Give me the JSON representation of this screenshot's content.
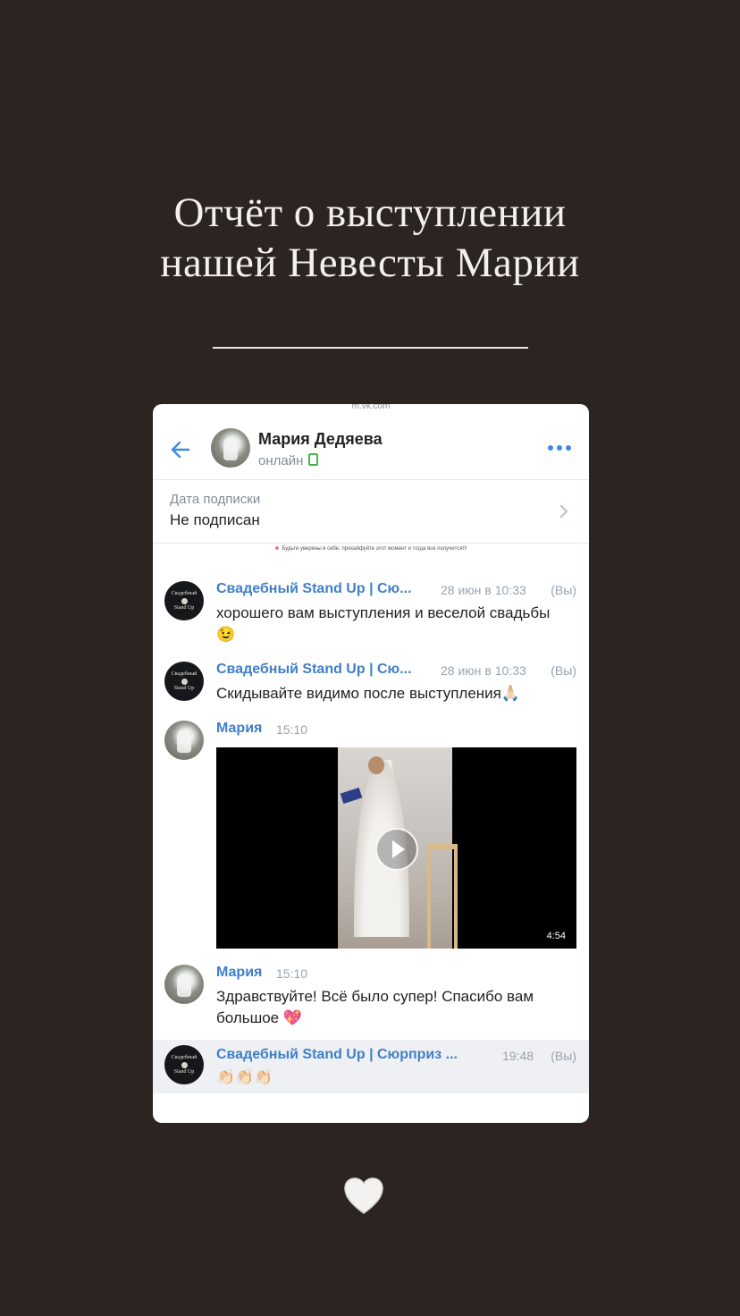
{
  "story": {
    "title_line1": "Отчёт о выступлении",
    "title_line2": "нашей Невесты Марии"
  },
  "browser": {
    "url": "m.vk.com"
  },
  "header": {
    "name": "Мария Дедяева",
    "status": "онлайн"
  },
  "subscription": {
    "label": "Дата подписки",
    "value": "Не подписан"
  },
  "pinned_note": "Будьте уверены в себе, прокайфуйте этот момент и тогда все получится!!!",
  "messages": [
    {
      "author": "Свадебный Stand Up | Сю...",
      "time": "28 июн в 10:33",
      "you": "(Вы)",
      "text": "хорошего вам выступления и веселой свадьбы",
      "emoji": "😉"
    },
    {
      "author": "Свадебный Stand Up | Сю...",
      "time": "28 июн в 10:33",
      "you": "(Вы)",
      "text": "Скидывайте видимо после выступления",
      "emoji": "🙏🏻"
    },
    {
      "author": "Мария",
      "time": "15:10",
      "video_duration": "4:54"
    },
    {
      "author": "Мария",
      "time": "15:10",
      "text": "Здравствуйте! Всё было супер! Спасибо вам большое",
      "emoji": "💖"
    },
    {
      "author": "Свадебный Stand Up | Сюрприз ...",
      "time": "19:48",
      "you": "(Вы)",
      "emoji": "👏🏻👏🏻👏🏻"
    }
  ],
  "brand_avatar": {
    "line1": "Свадебный",
    "line2": "Stand Up"
  },
  "colors": {
    "background": "#2b2420",
    "accent": "#3f8ae0",
    "author": "#3f7fc8"
  },
  "icons": [
    "back-arrow-icon",
    "more-dots-icon",
    "chevron-right-icon",
    "play-icon",
    "white-heart-icon"
  ]
}
